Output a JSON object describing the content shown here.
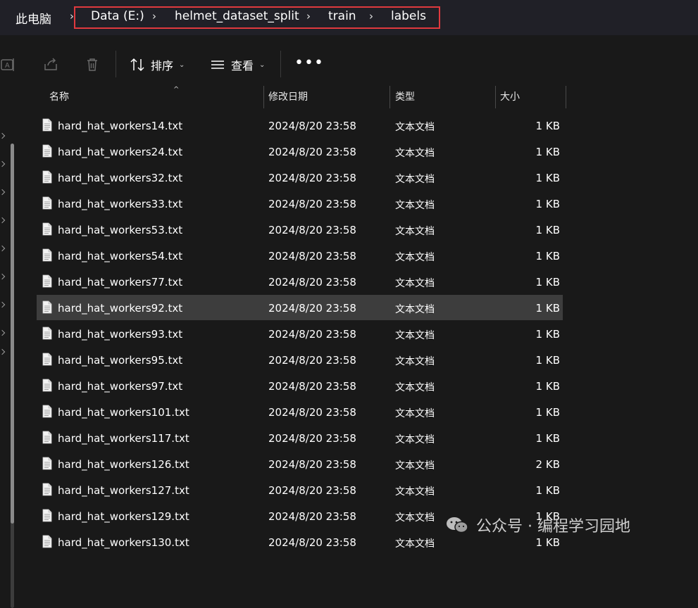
{
  "address_bar": {
    "root": "此电脑",
    "crumbs": [
      "Data (E:)",
      "helmet_dataset_split",
      "train",
      "labels"
    ],
    "highlight_color": "#e0393e"
  },
  "toolbar": {
    "sort_label": "排序",
    "view_label": "查看",
    "more_label": "•••",
    "icons": [
      "rename-icon",
      "share-icon",
      "delete-icon",
      "sort-icon",
      "view-icon",
      "more-icon"
    ]
  },
  "columns": {
    "name": "名称",
    "date": "修改日期",
    "type": "类型",
    "size": "大小"
  },
  "files": [
    {
      "name": "hard_hat_workers14.txt",
      "date": "2024/8/20 23:58",
      "type": "文本文档",
      "size": "1 KB"
    },
    {
      "name": "hard_hat_workers24.txt",
      "date": "2024/8/20 23:58",
      "type": "文本文档",
      "size": "1 KB"
    },
    {
      "name": "hard_hat_workers32.txt",
      "date": "2024/8/20 23:58",
      "type": "文本文档",
      "size": "1 KB"
    },
    {
      "name": "hard_hat_workers33.txt",
      "date": "2024/8/20 23:58",
      "type": "文本文档",
      "size": "1 KB"
    },
    {
      "name": "hard_hat_workers53.txt",
      "date": "2024/8/20 23:58",
      "type": "文本文档",
      "size": "1 KB"
    },
    {
      "name": "hard_hat_workers54.txt",
      "date": "2024/8/20 23:58",
      "type": "文本文档",
      "size": "1 KB"
    },
    {
      "name": "hard_hat_workers77.txt",
      "date": "2024/8/20 23:58",
      "type": "文本文档",
      "size": "1 KB"
    },
    {
      "name": "hard_hat_workers92.txt",
      "date": "2024/8/20 23:58",
      "type": "文本文档",
      "size": "1 KB",
      "selected": true
    },
    {
      "name": "hard_hat_workers93.txt",
      "date": "2024/8/20 23:58",
      "type": "文本文档",
      "size": "1 KB"
    },
    {
      "name": "hard_hat_workers95.txt",
      "date": "2024/8/20 23:58",
      "type": "文本文档",
      "size": "1 KB"
    },
    {
      "name": "hard_hat_workers97.txt",
      "date": "2024/8/20 23:58",
      "type": "文本文档",
      "size": "1 KB"
    },
    {
      "name": "hard_hat_workers101.txt",
      "date": "2024/8/20 23:58",
      "type": "文本文档",
      "size": "1 KB"
    },
    {
      "name": "hard_hat_workers117.txt",
      "date": "2024/8/20 23:58",
      "type": "文本文档",
      "size": "1 KB"
    },
    {
      "name": "hard_hat_workers126.txt",
      "date": "2024/8/20 23:58",
      "type": "文本文档",
      "size": "2 KB"
    },
    {
      "name": "hard_hat_workers127.txt",
      "date": "2024/8/20 23:58",
      "type": "文本文档",
      "size": "1 KB"
    },
    {
      "name": "hard_hat_workers129.txt",
      "date": "2024/8/20 23:58",
      "type": "文本文档",
      "size": "1 KB"
    },
    {
      "name": "hard_hat_workers130.txt",
      "date": "2024/8/20 23:58",
      "type": "文本文档",
      "size": "1 KB"
    }
  ],
  "watermark": {
    "text": "公众号 · 编程学习园地",
    "icon": "wechat-icon"
  }
}
